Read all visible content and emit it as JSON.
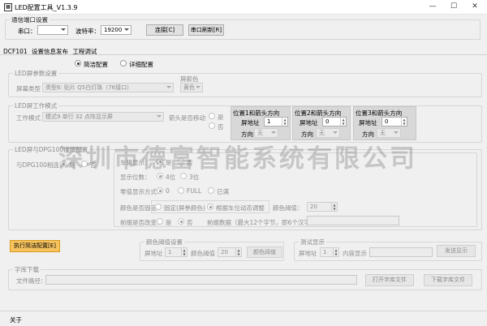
{
  "window": {
    "title": "LED配置工具_V1.3.9",
    "minimize": "—",
    "maximize": "☐",
    "close": "✕"
  },
  "comm": {
    "group_title": "通信端口设置",
    "port_label": "串口：",
    "port_value": "",
    "baud_label": "波特率：",
    "baud_value": "19200",
    "connect_button": "连接[C]",
    "refresh_button": "串口刷新[R]"
  },
  "tabs": [
    "DCF101",
    "设置信息发布",
    "工程调试"
  ],
  "mode": {
    "simple": "简洁配置",
    "detail": "详细配置"
  },
  "screen_params": {
    "group_title": "LED屏参数设置",
    "type_label": "屏幕类型",
    "type_value": "类型6: 贴片 Q5白灯珠（76接口）",
    "color_label": "屏颜色",
    "color_value": "黄色"
  },
  "work_mode": {
    "group_title": "LED屏工作模式",
    "mode_label": "工作模式",
    "mode_value": "模式9 单行 32 点阵显示屏",
    "arrow_move_label": "箭头是否移动",
    "yes": "是",
    "no": "否",
    "panels": [
      {
        "title": "位置1和箭头方向",
        "addr_label": "屏地址",
        "addr_value": "1",
        "dir_label": "方向",
        "dir_value": "无"
      },
      {
        "title": "位置2和箭头方向",
        "addr_label": "屏地址",
        "addr_value": "0",
        "dir_label": "方向",
        "dir_value": "无"
      },
      {
        "title": "位置3和箭头方向",
        "addr_label": "屏地址",
        "addr_value": "0",
        "dir_label": "方向",
        "dir_value": "无"
      }
    ]
  },
  "dpg": {
    "group_title": "LED屏与DPG100连接配置",
    "connect_label": "与DPG100相连：",
    "yes": "是",
    "no": "否",
    "brand_label": "车牌显示：",
    "brand_yes": "是",
    "brand_no": "否",
    "digits_label": "显示位数：",
    "digits_4": "4位",
    "digits_3": "3位",
    "zero_label": "零值显示方式：",
    "zero_0": "0",
    "zero_full": "FULL",
    "zero_off": "已满",
    "color_fixed_label": "颜色是否固定：",
    "color_fixed_opt": "固定(屏参颜色)",
    "color_dynamic_opt": "根据车位动态调整",
    "threshold_label": "颜色阈值：",
    "threshold_value": "20",
    "prefix_label": "前缀是否改变：",
    "prefix_yes": "是",
    "prefix_no": "否",
    "prefix_data_label": "前缀数据（最大12个字节，即6个汉字）"
  },
  "execute_button": "执行简洁配置[E]",
  "threshold_set": {
    "group_title": "颜色阈值设置",
    "addr_label": "屏地址",
    "addr_value": "1",
    "threshold_label": "颜色阈值",
    "threshold_value": "20",
    "button": "颜色阈值"
  },
  "test_display": {
    "group_title": "测试显示",
    "addr_label": "屏地址",
    "addr_value": "1",
    "content_label": "内容显示",
    "button": "发送显示"
  },
  "font_download": {
    "group_title": "字库下载",
    "path_label": "文件路径：",
    "open_button": "打开字库文件",
    "download_button": "下载字库文件"
  },
  "status": {
    "about": "关于"
  },
  "watermark": "深圳市德富智能系统有限公司"
}
